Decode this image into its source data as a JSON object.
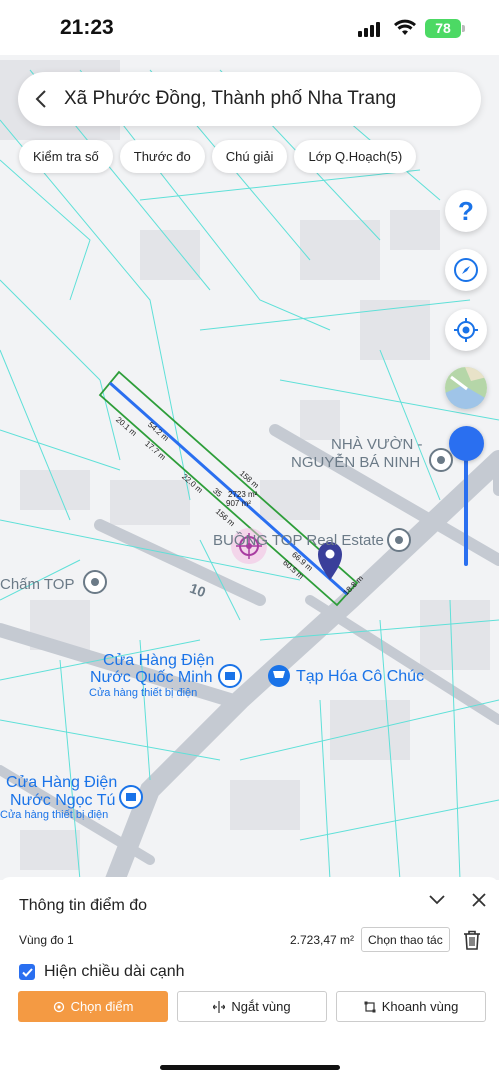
{
  "status": {
    "time": "21:23",
    "battery": "78"
  },
  "header": {
    "title": "Xã Phước Đồng, Thành phố Nha Trang"
  },
  "chips": [
    "Kiểm tra số",
    "Thước đo",
    "Chú giải",
    "Lớp Q.Hoạch(5)"
  ],
  "help": {
    "label": "?"
  },
  "map": {
    "labels": {
      "nha_vuon_1": "NHÀ VƯỜN -",
      "nha_vuon_2": "NGUYỄN BÁ NINH",
      "real_estate": "BUỒNG TOP Real Estate",
      "cham_top": "Chấm TOP",
      "road_number": "10",
      "cua_hang_1a": "Cửa Hàng Điện",
      "cua_hang_1b": "Nước Quốc Minh",
      "cua_hang_1c": "Cửa hàng thiết bị điện",
      "tap_hoa": "Tạp Hóa Cô Chúc",
      "cua_hang_2a": "Cửa Hàng Điện",
      "cua_hang_2b": "Nước Ngọc Tú",
      "cua_hang_2c": "Cửa hàng thiết bị điện"
    },
    "measurements": {
      "area": "2723 m²",
      "area_alt": "907 m²",
      "top_1": "54.2 m",
      "top_2": "158 m",
      "bottom_1": "20.1 m",
      "bottom_2": "17.7 m",
      "bottom_3": "22.0 m",
      "mid_1": "35",
      "mid_2": "156 m",
      "lower_1": "66.9 m",
      "lower_2": "60.5 m",
      "end": "18.8 m"
    }
  },
  "panel": {
    "title": "Thông tin điểm đo",
    "area_label": "Vùng đo 1",
    "area_value": "2.723,47 m²",
    "action_label": "Chọn thao tác",
    "checkbox_label": "Hiện chiều dài cạnh",
    "checkbox_checked": true,
    "btn_select_point": "Chọn điểm",
    "btn_cut_zone": "Ngắt vùng",
    "btn_zone": "Khoanh vùng"
  },
  "colors": {
    "accent": "#2a6ff0",
    "primary_button": "#f49a43",
    "parcel_outline": "#2e9e3a",
    "parcel_lines": "#5fe0d8",
    "pin": "#3a3f9a"
  }
}
